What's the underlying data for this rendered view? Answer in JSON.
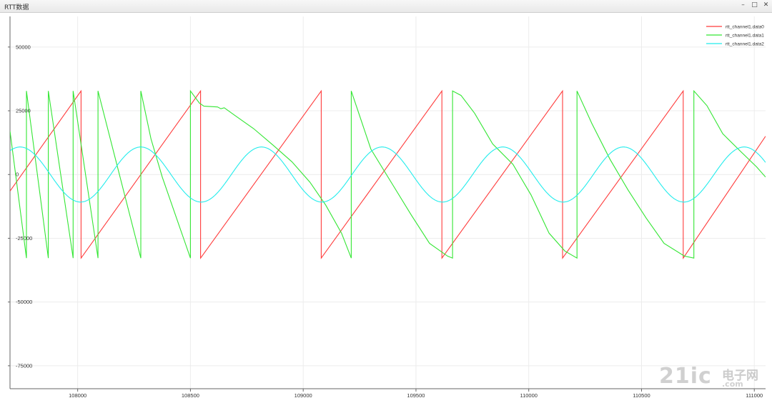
{
  "window": {
    "title": "RTT数据",
    "buttons": [
      "–",
      "□",
      "✕"
    ]
  },
  "watermark": {
    "logo": "21ic",
    "text_cn": "电子网",
    "url": ".com"
  },
  "chart_data": {
    "type": "line",
    "title": "",
    "xlabel": "",
    "ylabel": "",
    "xlim": [
      107700,
      111050
    ],
    "ylim": [
      -84000,
      62000
    ],
    "grid": true,
    "legend_position": "top-right",
    "x_ticks": [
      108000,
      108500,
      109000,
      109500,
      110000,
      110500,
      111000
    ],
    "y_ticks": [
      50000,
      25000,
      0,
      -25000,
      -50000,
      -75000
    ],
    "x_tick_labels": [
      "108000",
      "108500",
      "109000",
      "109500",
      "110000",
      "110500",
      "111000"
    ],
    "y_tick_labels": [
      "50000",
      "25000",
      "0",
      "-25000",
      "-50000",
      "-75000"
    ],
    "series": [
      {
        "name": "rtt_channel1.data0",
        "color": "#ff3b3b",
        "x": [
          107700,
          108015,
          108015,
          108545,
          108545,
          109080,
          109080,
          109615,
          109615,
          110150,
          110150,
          110685,
          110685,
          111050
        ],
        "y": [
          -6500,
          32767,
          -32768,
          32767,
          -32768,
          32767,
          -32768,
          32767,
          -32768,
          32767,
          -32768,
          32767,
          -32768,
          15000
        ]
      },
      {
        "name": "rtt_channel1.data1",
        "color": "#33e633",
        "x": [
          107700,
          107773,
          107773,
          107870,
          107870,
          107980,
          107980,
          108090,
          108090,
          108280,
          108280,
          108325,
          108375,
          108500,
          108500,
          108540,
          108560,
          108620,
          108635,
          108650,
          108700,
          108780,
          108860,
          108950,
          109030,
          109100,
          109170,
          109213,
          109213,
          109300,
          109390,
          109480,
          109560,
          109640,
          109662,
          109662,
          109700,
          109760,
          109840,
          109930,
          110010,
          110090,
          110160,
          110214,
          110214,
          110280,
          110360,
          110440,
          110520,
          110600,
          110690,
          110732,
          110732,
          110790,
          110860,
          110940,
          111010,
          111050
        ],
        "y": [
          17000,
          -32768,
          32767,
          -32768,
          32767,
          -32768,
          32767,
          -32768,
          32767,
          -32768,
          32767,
          14000,
          -1000,
          -32768,
          32767,
          28000,
          26800,
          26500,
          25800,
          26200,
          23000,
          18000,
          12000,
          5000,
          -3000,
          -12000,
          -23000,
          -32768,
          32767,
          10000,
          -3000,
          -16000,
          -27000,
          -32000,
          -32768,
          32767,
          31000,
          24000,
          12000,
          4000,
          -8000,
          -23000,
          -30000,
          -32768,
          32767,
          20000,
          6000,
          -6000,
          -17000,
          -27000,
          -32000,
          -32768,
          32767,
          27000,
          16000,
          9000,
          3000,
          -1000
        ]
      },
      {
        "name": "rtt_channel1.data2",
        "color": "#22ecec",
        "function": "sine",
        "amplitude": 10800,
        "period": 535,
        "peak_x": 108280
      }
    ]
  }
}
